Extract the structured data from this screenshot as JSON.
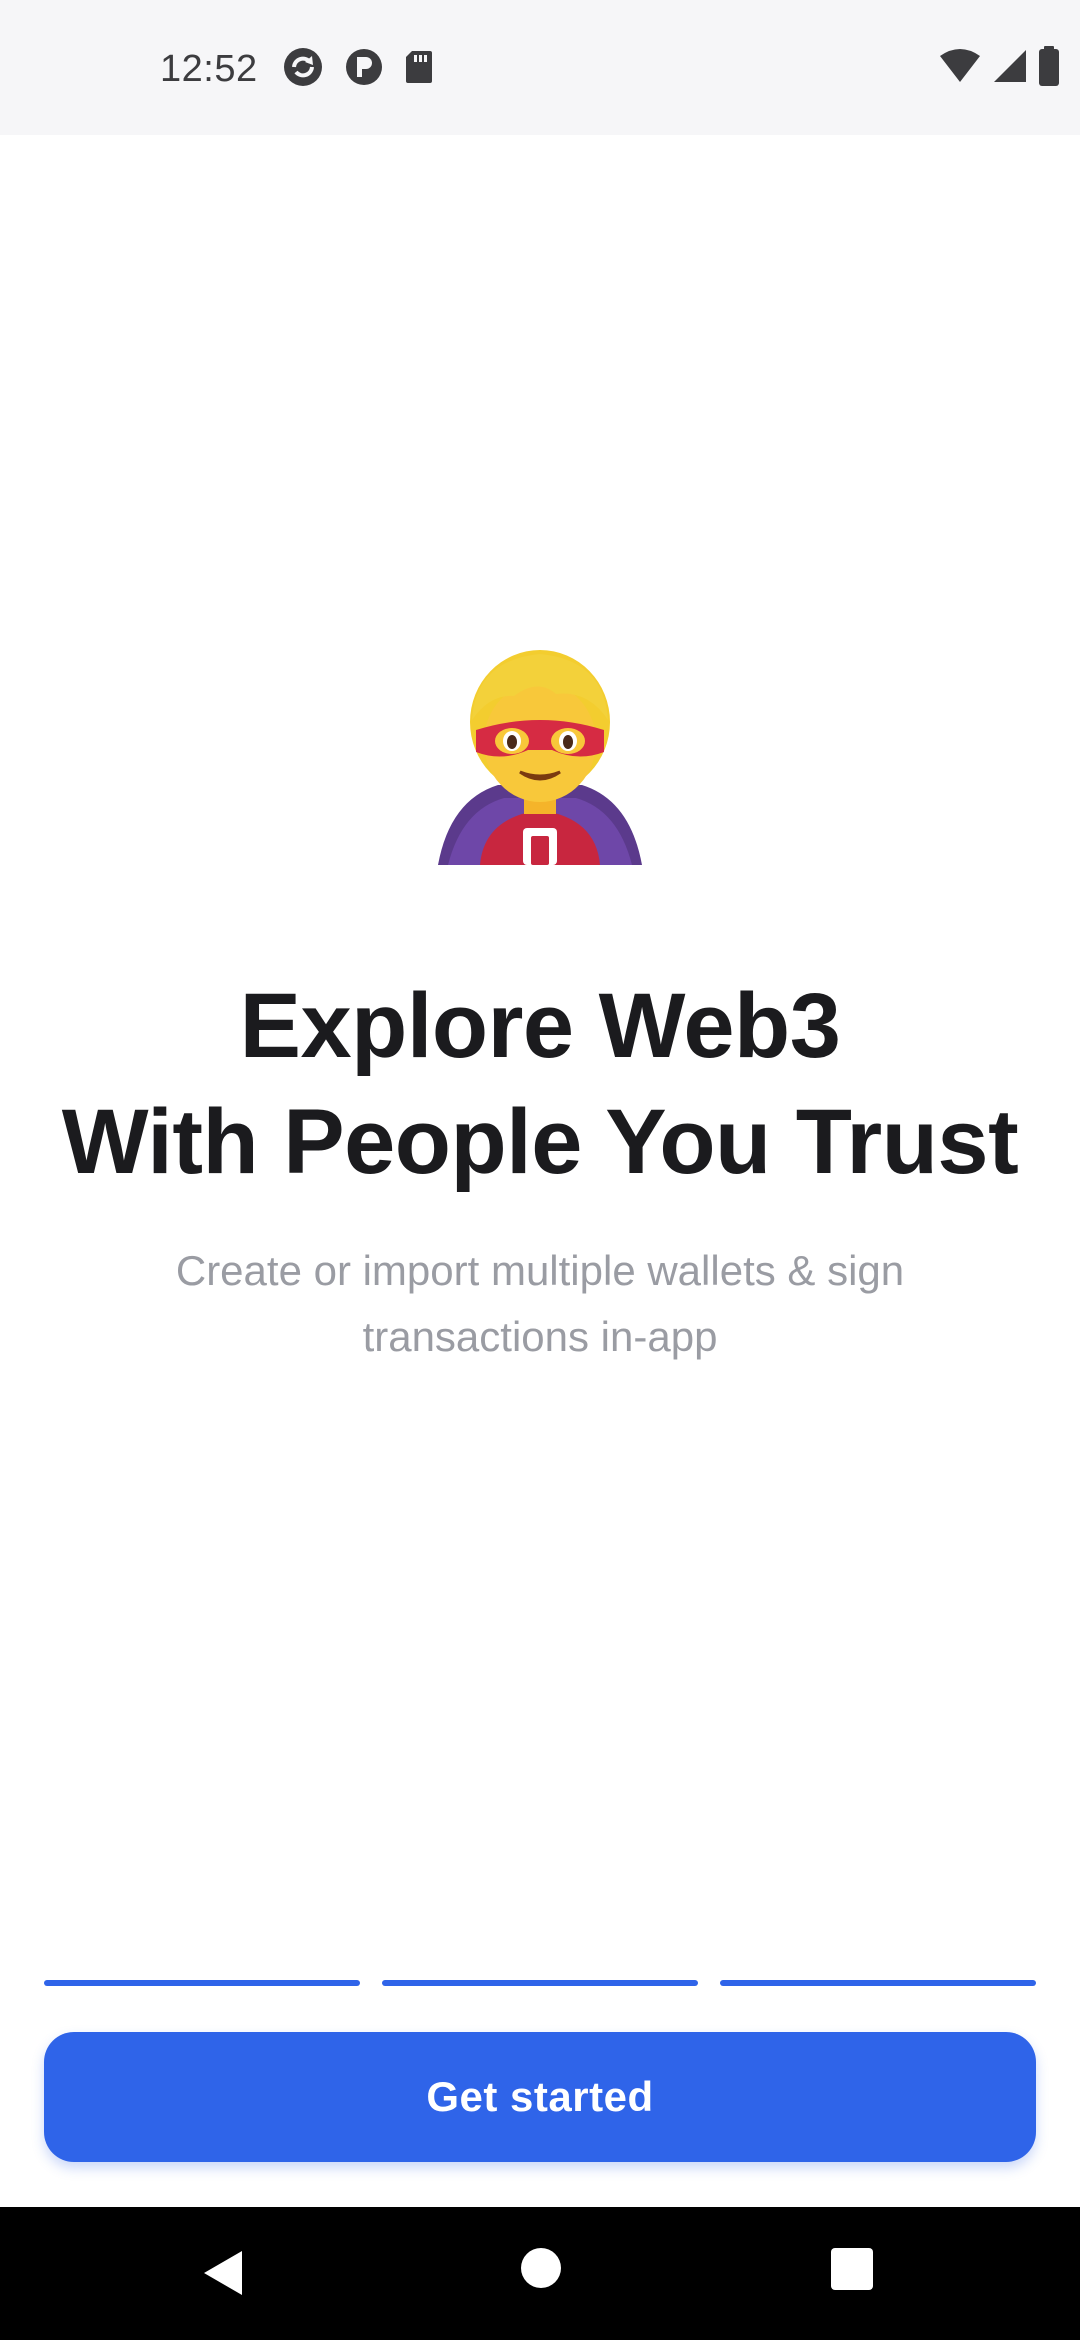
{
  "status_bar": {
    "time": "12:52",
    "left_icons": [
      "sync-icon",
      "app-p-icon",
      "sd-card-icon"
    ],
    "right_icons": [
      "wifi-icon",
      "cellular-signal-icon",
      "battery-icon"
    ]
  },
  "hero": {
    "emoji": "🦸",
    "emoji_name": "superhero-emoji"
  },
  "headline": {
    "line1": "Explore Web3",
    "line2": "With People You Trust"
  },
  "subtitle": {
    "line1": "Create or import multiple wallets & sign",
    "line2": "transactions in-app"
  },
  "progress": {
    "segments": 3,
    "completed": 3
  },
  "cta": {
    "label": "Get started"
  },
  "colors": {
    "accent": "#2f64e9",
    "headline": "#1b1b1e",
    "subtitle": "#9a9ca3",
    "status_bar_bg": "#f6f6f8",
    "nav_bar_bg": "#000000"
  },
  "nav_bar": {
    "icons": [
      "back-icon",
      "home-icon",
      "recents-icon"
    ]
  }
}
